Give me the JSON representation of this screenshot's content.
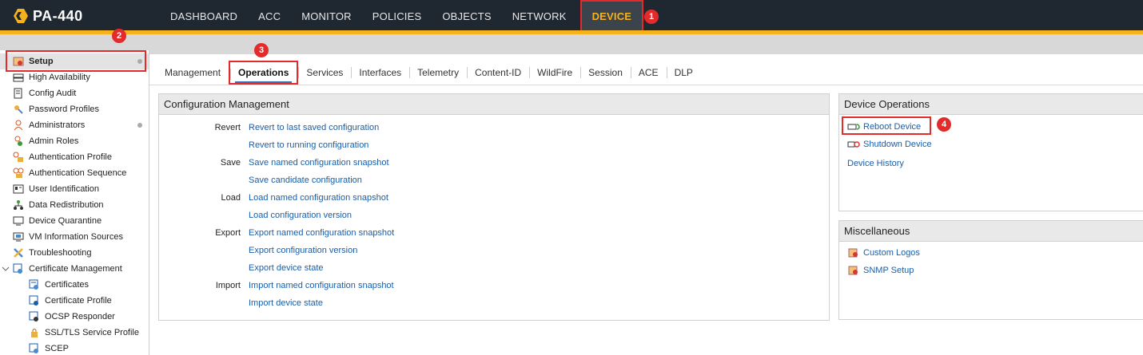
{
  "header": {
    "logo_text": "PA-440",
    "nav": [
      "DASHBOARD",
      "ACC",
      "MONITOR",
      "POLICIES",
      "OBJECTS",
      "NETWORK",
      "DEVICE"
    ],
    "active_nav": "DEVICE",
    "accent_color": "#f7b21b"
  },
  "sidebar": {
    "items": [
      {
        "label": "Setup",
        "icon": "setup-icon",
        "selected": true,
        "dot": true
      },
      {
        "label": "High Availability",
        "icon": "ha-icon"
      },
      {
        "label": "Config Audit",
        "icon": "audit-icon"
      },
      {
        "label": "Password Profiles",
        "icon": "key-icon"
      },
      {
        "label": "Administrators",
        "icon": "user-icon",
        "dot": true
      },
      {
        "label": "Admin Roles",
        "icon": "role-icon"
      },
      {
        "label": "Authentication Profile",
        "icon": "auth-profile-icon"
      },
      {
        "label": "Authentication Sequence",
        "icon": "auth-seq-icon"
      },
      {
        "label": "User Identification",
        "icon": "id-card-icon"
      },
      {
        "label": "Data Redistribution",
        "icon": "redistribution-icon"
      },
      {
        "label": "Device Quarantine",
        "icon": "quarantine-icon"
      },
      {
        "label": "VM Information Sources",
        "icon": "vm-icon"
      },
      {
        "label": "Troubleshooting",
        "icon": "wrench-icon"
      },
      {
        "label": "Certificate Management",
        "icon": "cert-mgmt-icon",
        "expanded": true
      },
      {
        "label": "Certificates",
        "icon": "certificate-icon",
        "sub": true
      },
      {
        "label": "Certificate Profile",
        "icon": "cert-profile-icon",
        "sub": true
      },
      {
        "label": "OCSP Responder",
        "icon": "ocsp-icon",
        "sub": true
      },
      {
        "label": "SSL/TLS Service Profile",
        "icon": "lock-icon",
        "sub": true
      },
      {
        "label": "SCEP",
        "icon": "scep-icon",
        "sub": true
      }
    ]
  },
  "tabs": {
    "items": [
      "Management",
      "Operations",
      "Services",
      "Interfaces",
      "Telemetry",
      "Content-ID",
      "WildFire",
      "Session",
      "ACE",
      "DLP"
    ],
    "active": "Operations"
  },
  "config_mgmt": {
    "title": "Configuration Management",
    "rows": [
      {
        "label": "Revert",
        "link": "Revert to last saved configuration"
      },
      {
        "label": "",
        "link": "Revert to running configuration"
      },
      {
        "label": "Save",
        "link": "Save named configuration snapshot"
      },
      {
        "label": "",
        "link": "Save candidate configuration"
      },
      {
        "label": "Load",
        "link": "Load named configuration snapshot"
      },
      {
        "label": "",
        "link": "Load configuration version"
      },
      {
        "label": "Export",
        "link": "Export named configuration snapshot"
      },
      {
        "label": "",
        "link": "Export configuration version"
      },
      {
        "label": "",
        "link": "Export device state"
      },
      {
        "label": "Import",
        "link": "Import named configuration snapshot"
      },
      {
        "label": "",
        "link": "Import device state"
      }
    ]
  },
  "device_ops": {
    "title": "Device Operations",
    "reboot": "Reboot Device",
    "shutdown": "Shutdown Device",
    "history": "Device History"
  },
  "misc": {
    "title": "Miscellaneous",
    "custom_logos": "Custom Logos",
    "snmp_setup": "SNMP Setup"
  },
  "markers": [
    "1",
    "2",
    "3",
    "4"
  ],
  "annotation_color": "#e32b2b",
  "link_color": "#1a5ea8"
}
